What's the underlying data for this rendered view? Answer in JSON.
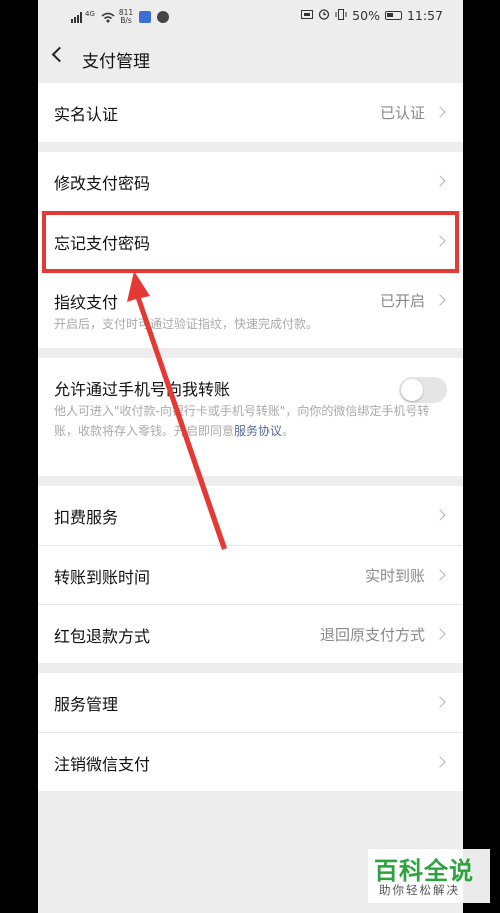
{
  "status_bar": {
    "network": "4G",
    "speed_value": "811",
    "speed_unit": "B/s",
    "battery": "50%",
    "time": "11:57"
  },
  "header": {
    "title": "支付管理"
  },
  "groups": [
    {
      "rows": [
        {
          "label": "实名认证",
          "value": "已认证"
        }
      ]
    },
    {
      "rows": [
        {
          "label": "修改支付密码"
        },
        {
          "label": "忘记支付密码"
        },
        {
          "label": "指纹支付",
          "value": "已开启",
          "description": "开启后，支付时可通过验证指纹，快速完成付款。"
        }
      ]
    },
    {
      "rows": [
        {
          "label": "允许通过手机号向我转账",
          "toggle": false,
          "description": "他人可进入\"收付款-向银行卡或手机号转账\"，向你的微信绑定手机号转账，收款将存入零钱。开启即同意",
          "link": "服务协议",
          "description_end": "。"
        }
      ]
    },
    {
      "rows": [
        {
          "label": "扣费服务"
        },
        {
          "label": "转账到账时间",
          "value": "实时到账"
        },
        {
          "label": "红包退款方式",
          "value": "退回原支付方式"
        }
      ]
    },
    {
      "rows": [
        {
          "label": "服务管理"
        },
        {
          "label": "注销微信支付"
        }
      ]
    }
  ],
  "annotation": {
    "highlight_color": "#e53936"
  },
  "watermark": {
    "title": "百科全说",
    "subtitle": "助你轻松解决"
  }
}
